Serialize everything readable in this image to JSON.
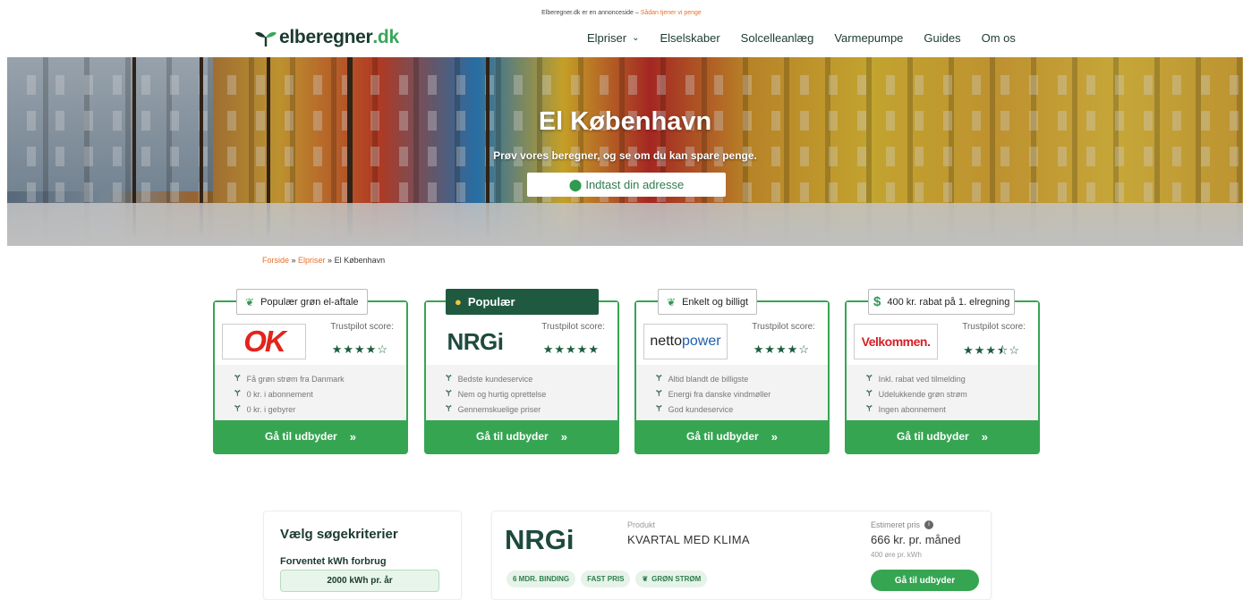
{
  "notice": {
    "text": "Elberegner.dk er en annonceside – ",
    "link": "Sådan tjener vi penge"
  },
  "header": {
    "logo_main": "elberegner",
    "logo_tld": ".dk",
    "nav": [
      "Elpriser",
      "Elselskaber",
      "Solcelleanlæg",
      "Varmepumpe",
      "Guides",
      "Om os"
    ]
  },
  "hero": {
    "title": "El København",
    "subtitle": "Prøv vores beregner, og se om du kan spare penge.",
    "address_cta": "Indtast din adresse"
  },
  "breadcrumb": {
    "home": "Forside",
    "sep1": " » ",
    "parent": "Elpriser",
    "sep2": " » ",
    "current": "El København"
  },
  "cards": [
    {
      "tag": "Populær grøn el-aftale",
      "logo_text": "OK",
      "trustpilot_label": "Trustpilot score:",
      "stars": "★★★★☆",
      "features": [
        "Få grøn strøm fra Danmark",
        "0 kr. i abonnement",
        "0 kr. i gebyrer"
      ],
      "cta": "Gå til udbyder"
    },
    {
      "tag": "Populær",
      "logo_text": "NRGi",
      "trustpilot_label": "Trustpilot score:",
      "stars": "★★★★★",
      "features": [
        "Bedste kundeservice",
        "Nem og hurtig oprettelse",
        "Gennemskuelige priser"
      ],
      "cta": "Gå til udbyder"
    },
    {
      "tag": "Enkelt og billigt",
      "logo_text": "netto",
      "logo_text2": "power",
      "trustpilot_label": "Trustpilot score:",
      "stars": "★★★★☆",
      "features": [
        "Altid blandt de billigste",
        "Energi fra danske vindmøller",
        "God kundeservice"
      ],
      "cta": "Gå til udbyder"
    },
    {
      "tag": "400 kr. rabat på 1. elregning",
      "logo_text": "Velkommen.",
      "trustpilot_label": "Trustpilot score:",
      "stars": "★★★⯪☆",
      "features": [
        "Inkl. rabat ved tilmelding",
        "Udelukkende grøn strøm",
        "Ingen abonnement"
      ],
      "cta": "Gå til udbyder"
    }
  ],
  "criteria": {
    "title": "Vælg søgekriterier",
    "label": "Forventet kWh forbrug",
    "value": "2000 kWh pr. år"
  },
  "product": {
    "logo": "NRGi",
    "label": "Produkt",
    "name": "KVARTAL MED KLIMA",
    "pills": [
      "6 MDR. BINDING",
      "FAST PRIS",
      "GRØN STRØM"
    ],
    "est_label": "Estimeret pris",
    "price": "666 kr. pr. måned",
    "sub": "400 øre pr. kWh",
    "cta": "Gå til udbyder"
  },
  "colors": {
    "accent": "#36a552",
    "dark": "#1f5a40",
    "orange": "#e8712b"
  }
}
